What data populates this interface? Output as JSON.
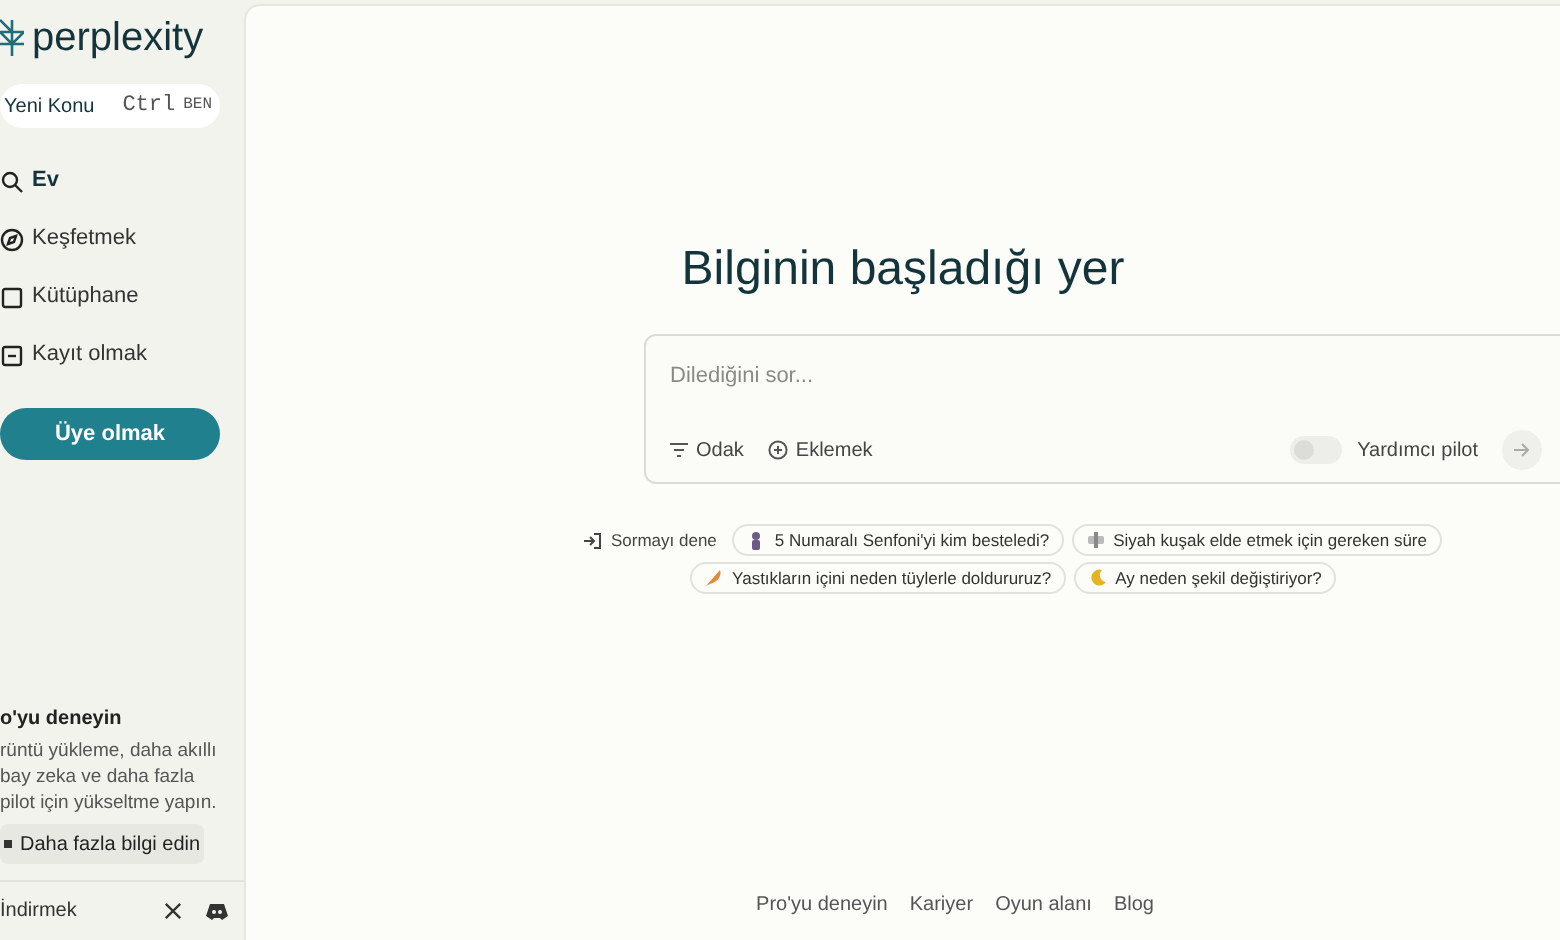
{
  "sidebar": {
    "logo": "perplexity",
    "new_thread": {
      "label": "Yeni Konu",
      "shortcut_keys": [
        "Ctrl",
        "BEN"
      ]
    },
    "items": [
      {
        "label": "Ev",
        "selected": true,
        "kind": "search"
      },
      {
        "label": "Keşfetmek",
        "selected": false,
        "kind": "compass"
      },
      {
        "label": "Kütüphane",
        "selected": false,
        "kind": "library"
      },
      {
        "label": "Kayıt olmak",
        "selected": false,
        "kind": "signin"
      }
    ],
    "signup_button": "Üye olmak",
    "promo": {
      "title": "o'yu deneyin",
      "lines": [
        "rüntü yükleme, daha akıllı",
        "bay zeka ve daha fazla",
        "pilot için yükseltme yapın."
      ],
      "button": "Daha fazla bilgi edin"
    },
    "download": "İndirmek"
  },
  "main": {
    "heading": "Bilginin başladığı yer",
    "search": {
      "placeholder": "Dilediğini sor...",
      "focus": "Odak",
      "attach": "Eklemek",
      "copilot": {
        "label": "Yardımcı pilot",
        "on": false
      }
    },
    "try_label": "Sormayı dene",
    "suggestions": [
      [
        {
          "text": "5 Numaralı Senfoni'yi kim besteledi?",
          "kind": "composer"
        },
        {
          "text": "Siyah kuşak elde etmek için gereken süre",
          "kind": "martial"
        }
      ],
      [
        {
          "text": "Yastıkların içini neden tüylerle doldururuz?",
          "kind": "feather"
        },
        {
          "text": "Ay neden şekil değiştiriyor?",
          "kind": "moon"
        }
      ]
    ],
    "footer_links": [
      "Pro'yu deneyin",
      "Kariyer",
      "Oyun alanı",
      "Blog"
    ]
  }
}
